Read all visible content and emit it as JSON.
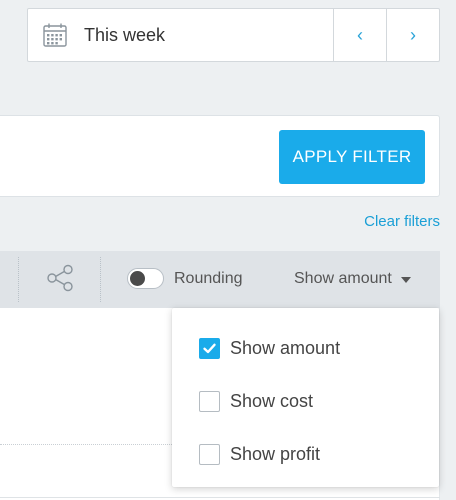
{
  "date_picker": {
    "label": "This week",
    "prev_glyph": "‹",
    "next_glyph": "›",
    "icon": "calendar-icon"
  },
  "filter": {
    "apply_label": "APPLY FILTER",
    "clear_label": "Clear filters"
  },
  "toolbar": {
    "share_icon": "share-icon",
    "rounding_label": "Rounding",
    "rounding_on": false,
    "show_label": "Show amount"
  },
  "dropdown": {
    "options": [
      {
        "label": "Show amount",
        "checked": true
      },
      {
        "label": "Show cost",
        "checked": false
      },
      {
        "label": "Show profit",
        "checked": false
      }
    ]
  },
  "colors": {
    "accent": "#1aabea",
    "link": "#1a9fd6",
    "background": "#edf0f2"
  }
}
